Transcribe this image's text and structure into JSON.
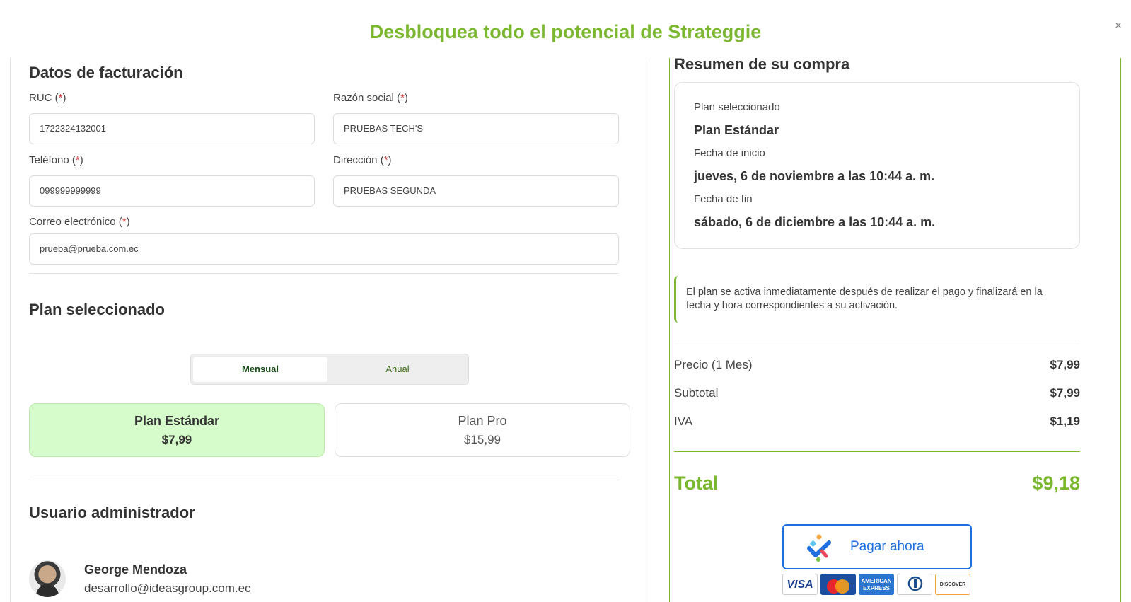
{
  "modal": {
    "title": "Desbloquea todo el potencial de Strateggie",
    "close_label": "×"
  },
  "billing": {
    "title": "Datos de facturación",
    "ruc": {
      "label": "RUC",
      "value": "1722324132001"
    },
    "razon": {
      "label": "Razón social",
      "value": "PRUEBAS TECH'S"
    },
    "telefono": {
      "label": "Teléfono",
      "value": "099999999999"
    },
    "direccion": {
      "label": "Dirección",
      "value": "PRUEBAS SEGUNDA"
    },
    "correo": {
      "label": "Correo electrónico",
      "value": "prueba@prueba.com.ec"
    },
    "required_mark": "*"
  },
  "plan": {
    "title": "Plan seleccionado",
    "toggle": {
      "monthly": "Mensual",
      "yearly": "Anual",
      "selected": "Mensual"
    },
    "cards": [
      {
        "name": "Plan Estándar",
        "price": "$7,99",
        "selected": true
      },
      {
        "name": "Plan Pro",
        "price": "$15,99",
        "selected": false
      }
    ]
  },
  "admin": {
    "title": "Usuario administrador",
    "name": "George Mendoza",
    "email": "desarrollo@ideasgroup.com.ec"
  },
  "summary": {
    "title": "Resumen de su compra",
    "plan_label": "Plan seleccionado",
    "plan_value": "Plan Estándar",
    "start_label": "Fecha de inicio",
    "start_value": "jueves, 6 de noviembre a las 10:44 a. m.",
    "end_label": "Fecha de fin",
    "end_value": "sábado, 6 de diciembre a las 10:44 a. m.",
    "notice": "El plan se activa inmediatamente después de realizar el pago y finalizará en la fecha y hora correspondientes a su activación.",
    "price_label": "Precio (1 Mes)",
    "price_value": "$7,99",
    "subtotal_label": "Subtotal",
    "subtotal_value": "$7,99",
    "iva_label": "IVA",
    "iva_value": "$1,19",
    "total_label": "Total",
    "total_value": "$9,18"
  },
  "payment": {
    "button_label": "Pagar ahora",
    "cards": [
      "VISA",
      "mastercard-logo",
      "AMERICAN EXPRESS",
      "diners-logo",
      "DISCOVER"
    ]
  },
  "colors": {
    "accent": "#7cb82f",
    "selected_plan_bg": "#d5fcca",
    "pay_blue": "#1f6fe0",
    "required": "#e03131"
  }
}
